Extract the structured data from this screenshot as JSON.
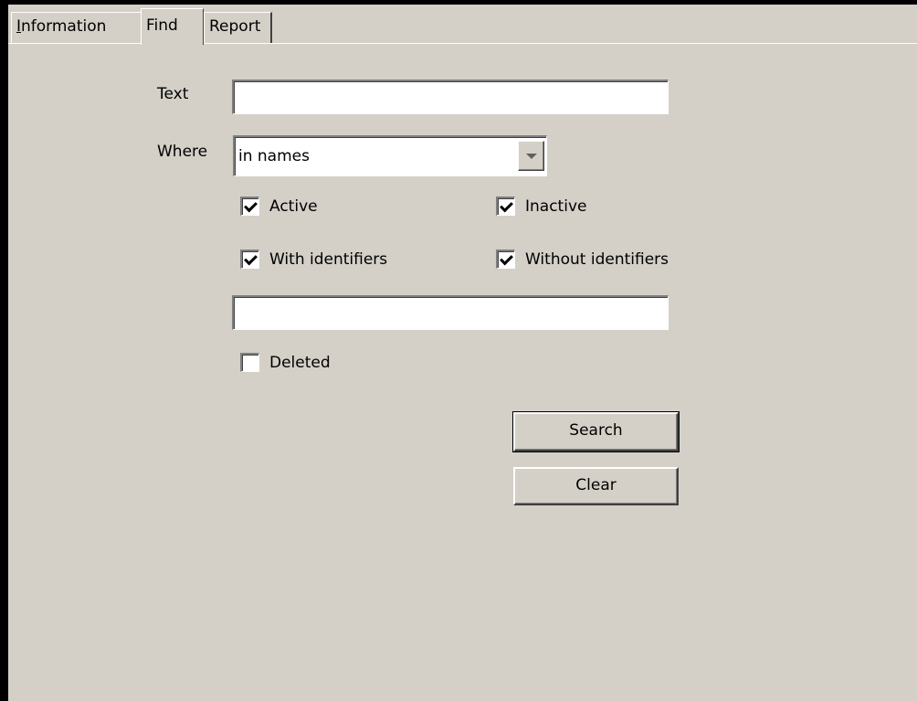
{
  "tabs": [
    {
      "label": "Information",
      "accel": "I"
    },
    {
      "label": "Find"
    },
    {
      "label": "Report"
    }
  ],
  "form": {
    "text_label": "Text",
    "text_value": "",
    "where_label": "Where",
    "where_selected": "in names",
    "extra_value": ""
  },
  "checkboxes": {
    "active": {
      "label": "Active",
      "checked": true
    },
    "inactive": {
      "label": "Inactive",
      "checked": true
    },
    "with_identifiers": {
      "label": "With identifiers",
      "checked": true
    },
    "without_identifiers": {
      "label": "Without identifiers",
      "checked": true
    },
    "deleted": {
      "label": "Deleted",
      "checked": false
    }
  },
  "buttons": {
    "search": "Search",
    "clear": "Clear"
  },
  "colors": {
    "face": "#d4d0c8",
    "window_bg": "#ffffff"
  }
}
